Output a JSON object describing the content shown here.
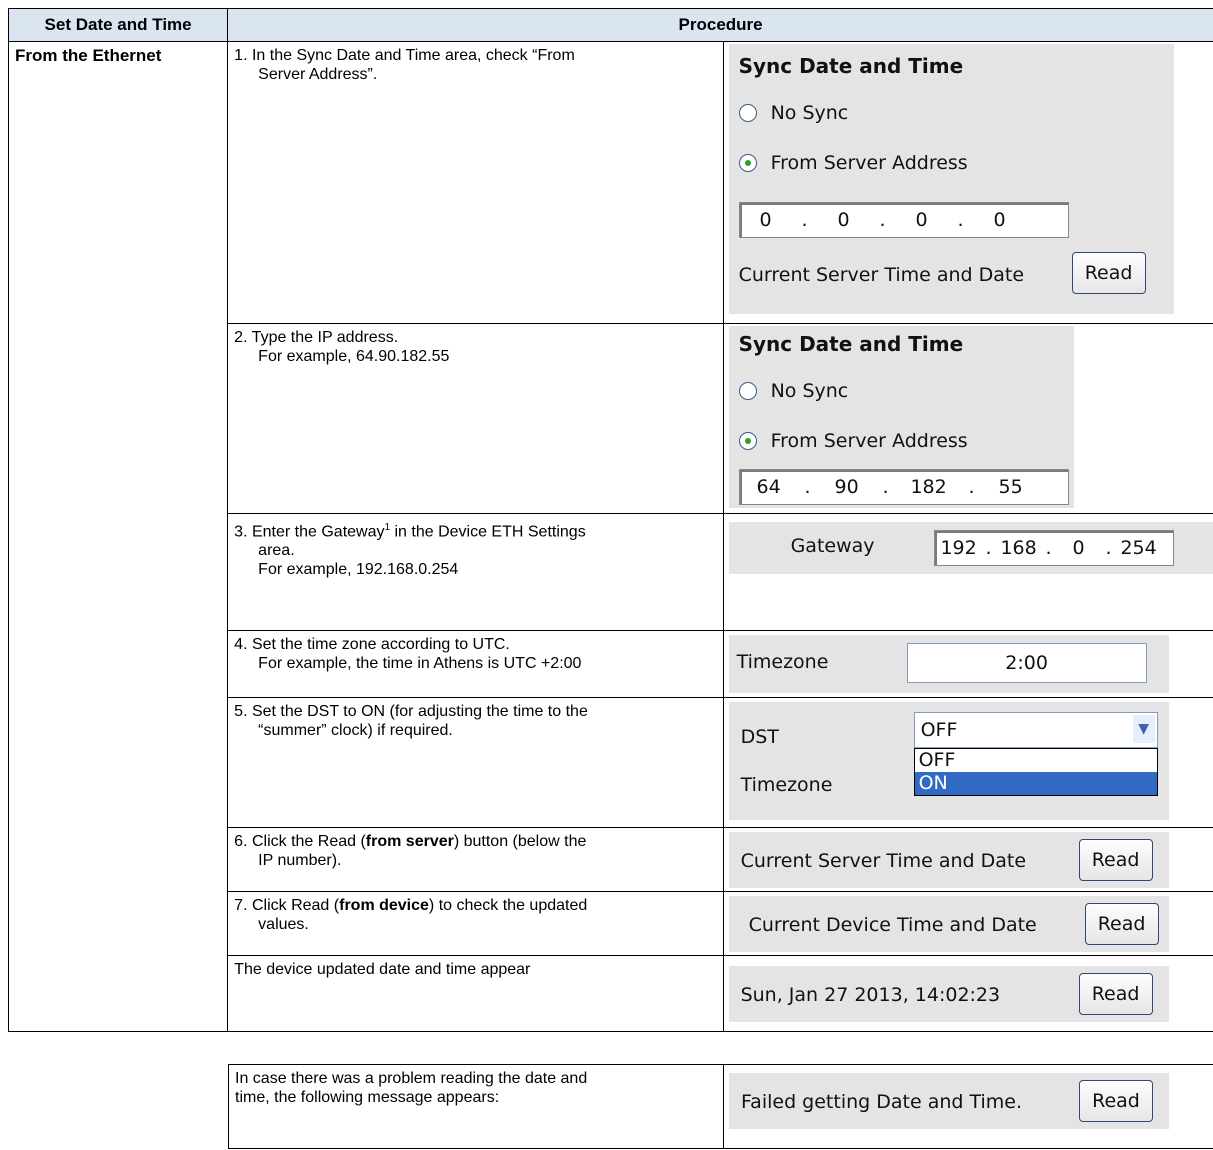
{
  "header": {
    "col1": "Set Date and Time",
    "col2": "Procedure"
  },
  "method": "From the Ethernet",
  "steps": [
    {
      "num": "1.",
      "text": "In the Sync Date and Time area, check “From",
      "text2": "Server Address”."
    },
    {
      "num": "2.",
      "text": "Type the IP address.",
      "text2": "For example, 64.90.182.55"
    },
    {
      "num": "3.",
      "text_a": "Enter the Gateway",
      "sup": "1",
      "text_b": " in the Device ETH Settings",
      "text2": "area.",
      "text3": "For example, 192.168.0.254"
    },
    {
      "num": "4.",
      "text": "Set the time zone according to UTC.",
      "text2": "For example, the time in Athens is UTC +2:00"
    },
    {
      "num": "5.",
      "text": "Set the DST to ON (for adjusting the time to the",
      "text2": "“summer” clock) if required."
    },
    {
      "num": "6.",
      "text_a": "Click the Read (",
      "bold": "from server",
      "text_b": ") button (below the",
      "text2": "IP number)."
    },
    {
      "num": "7.",
      "text_a": "Click Read (",
      "bold": "from device",
      "text_b": ") to check the updated",
      "text2": "values."
    },
    {
      "text": "The device updated date and time appear"
    }
  ],
  "shot1": {
    "title": "Sync Date and Time",
    "radio_no_sync": "No Sync",
    "radio_server": "From Server Address",
    "ip": [
      "0",
      "0",
      "0",
      "0"
    ],
    "dot": ".",
    "current_label": "Current Server Time and Date",
    "read": "Read"
  },
  "shot2": {
    "title": "Sync Date and Time",
    "radio_no_sync": "No Sync",
    "radio_server": "From Server Address",
    "ip": [
      "64",
      "90",
      "182",
      "55"
    ],
    "dot": "."
  },
  "shot3": {
    "label": "Gateway",
    "ip": [
      "192",
      "168",
      "0",
      "254"
    ],
    "dot": "."
  },
  "shot4": {
    "label": "Timezone",
    "value": "2:00"
  },
  "shot5": {
    "label_dst": "DST",
    "value": "OFF",
    "label_tz": "Timezone",
    "options": [
      "OFF",
      "ON"
    ],
    "selected": "ON"
  },
  "shot6": {
    "label": "Current Server Time and Date",
    "read": "Read"
  },
  "shot7": {
    "label": "Current Device Time and Date",
    "read": "Read"
  },
  "shot8": {
    "label": "Sun, Jan 27 2013, 14:02:23",
    "read": "Read"
  },
  "footer": {
    "text": "In case there was a problem reading the date and",
    "text2": "time, the following message appears:",
    "shot_label": "Failed getting Date and Time.",
    "read": "Read"
  },
  "colors": {
    "header_bg": "#dbe5f1",
    "panel_bg": "#e4e4e4",
    "selection": "#316ac5",
    "radio_dot": "#2aa12a"
  }
}
